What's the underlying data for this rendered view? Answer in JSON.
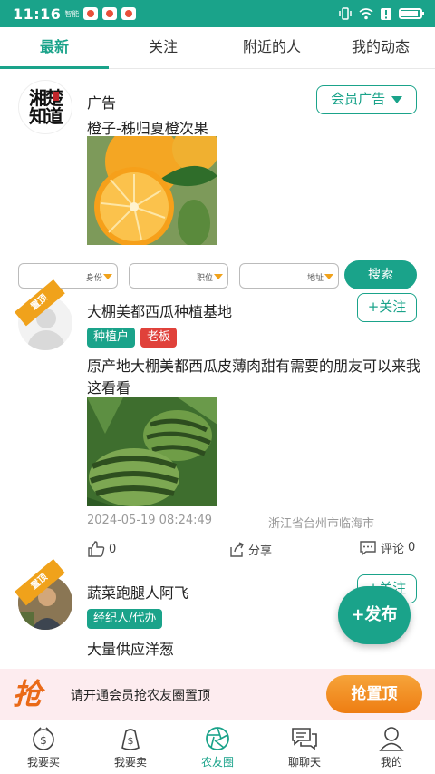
{
  "status_bar": {
    "time": "11:16",
    "carrier_label": "智能"
  },
  "tabs": [
    {
      "label": "最新",
      "active": true
    },
    {
      "label": "关注",
      "active": false
    },
    {
      "label": "附近的人",
      "active": false
    },
    {
      "label": "我的动态",
      "active": false
    }
  ],
  "ad_post": {
    "avatar_logo_text": "湘楚知道",
    "name": "广告",
    "member_ad_button": "会员广告",
    "text": "橙子-秭归夏橙次果"
  },
  "filters": {
    "identity": "身份",
    "position": "职位",
    "address": "地址",
    "search_button": "搜索"
  },
  "post1": {
    "badge": "置顶",
    "name": "大棚美都西瓜种植基地",
    "follow_button": "+关注",
    "tags": [
      "种植户",
      "老板"
    ],
    "text": "原产地大棚美都西瓜皮薄肉甜有需要的朋友可以来我这看看",
    "timestamp": "2024-05-19 08:24:49",
    "location": "浙江省台州市临海市",
    "likes": "0",
    "share_label": "分享",
    "comment_label": "评论",
    "comments": "0"
  },
  "post2": {
    "badge": "置顶",
    "name": "蔬菜跑腿人阿飞",
    "follow_button": "+关注",
    "tags": [
      "经纪人/代办"
    ],
    "text": "大量供应洋葱"
  },
  "fab": {
    "label": "+发布"
  },
  "promo": {
    "icon_text": "抢",
    "text": "请开通会员抢农友圈置顶",
    "button": "抢置顶"
  },
  "bottom_nav": [
    {
      "label": "我要买",
      "icon": "money-bag-icon",
      "active": false
    },
    {
      "label": "我要卖",
      "icon": "sell-bag-icon",
      "active": false
    },
    {
      "label": "农友圈",
      "icon": "aperture-icon",
      "active": true
    },
    {
      "label": "聊聊天",
      "icon": "chat-icon",
      "active": false
    },
    {
      "label": "我的",
      "icon": "person-icon",
      "active": false
    }
  ],
  "colors": {
    "primary": "#1aa38a",
    "red_tag": "#e0413a",
    "orange": "#f0a21b",
    "promo_bg": "#fdecef"
  }
}
